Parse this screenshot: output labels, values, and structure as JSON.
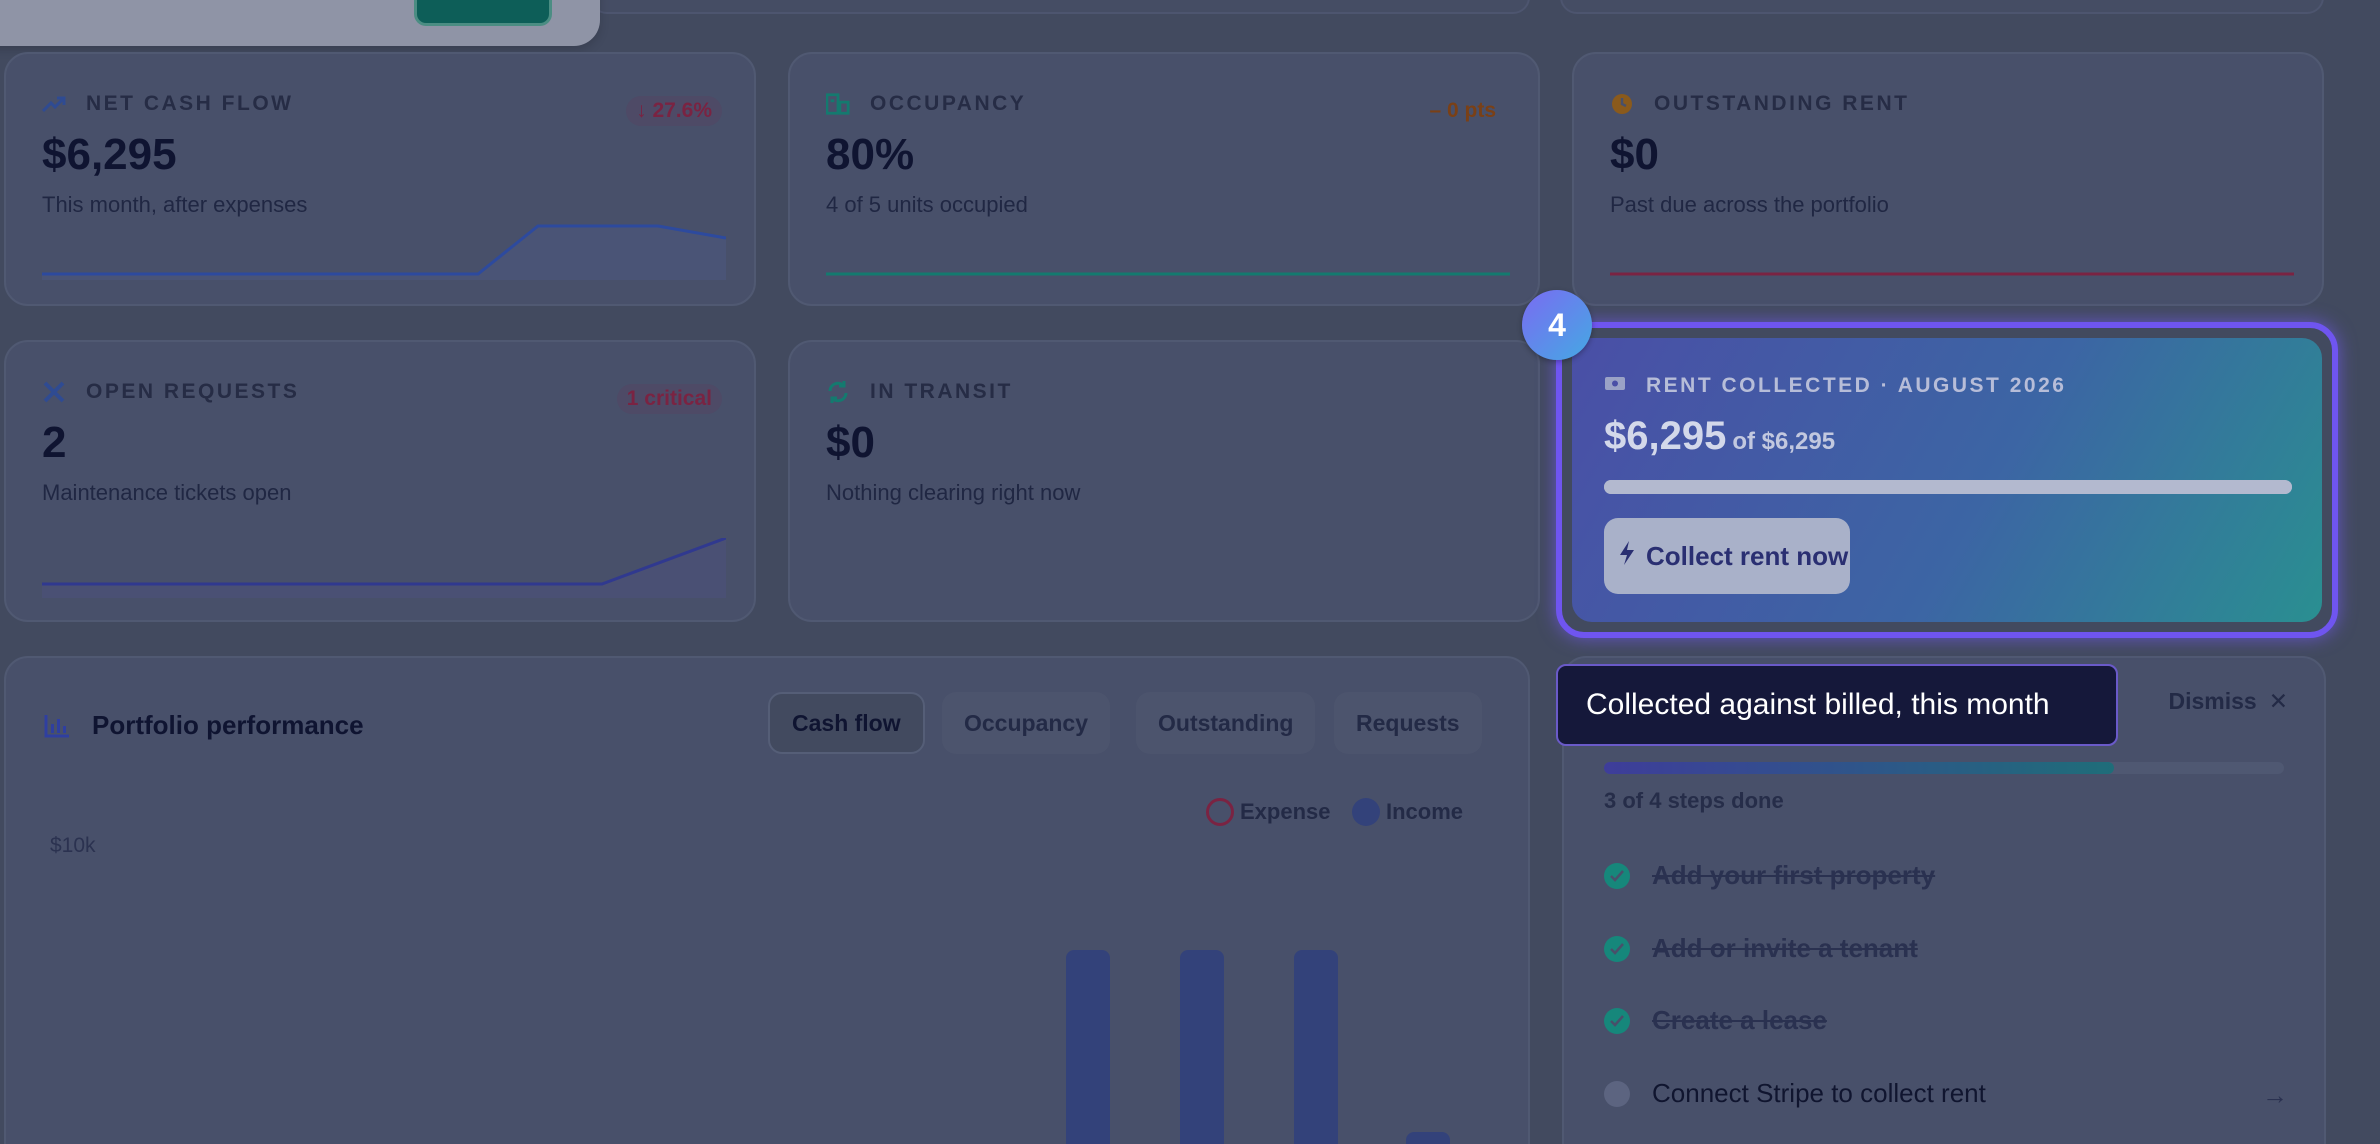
{
  "kpis": {
    "net_cash_flow": {
      "label": "NET CASH FLOW",
      "value": "$6,295",
      "sub": "This month, after expenses",
      "badge": "↓ 27.6%",
      "badge_color": "#7a2342"
    },
    "occupancy": {
      "label": "OCCUPANCY",
      "value": "80%",
      "sub": "4 of 5 units occupied",
      "badge": "– 0 pts",
      "badge_color": "#7a4016"
    },
    "outstanding_rent": {
      "label": "OUTSTANDING RENT",
      "value": "$0",
      "sub": "Past due across the portfolio"
    },
    "open_requests": {
      "label": "OPEN REQUESTS",
      "value": "2",
      "sub": "Maintenance tickets open",
      "badge": "1 critical",
      "badge_color": "#7a2342"
    },
    "in_transit": {
      "label": "IN TRANSIT",
      "value": "$0",
      "sub": "Nothing clearing right now"
    }
  },
  "rent_collected": {
    "label": "RENT COLLECTED · AUGUST 2026",
    "value": "$6,295",
    "of": "of $6,295",
    "progress": 1.0,
    "button": "Collect rent now"
  },
  "tour": {
    "step": "4",
    "tooltip": "Collected against billed, this month"
  },
  "performance": {
    "title": "Portfolio performance",
    "tabs": [
      "Cash flow",
      "Occupancy",
      "Outstanding",
      "Requests"
    ],
    "active_tab": "Cash flow",
    "legend": {
      "expense": "Expense",
      "income": "Income"
    },
    "ytick": "$10k"
  },
  "onboarding": {
    "dismiss": "Dismiss",
    "progress": 0.75,
    "count": "3 of 4 steps done",
    "steps": [
      {
        "label": "Add your first property",
        "done": true
      },
      {
        "label": "Add or invite a tenant",
        "done": true
      },
      {
        "label": "Create a lease",
        "done": true
      },
      {
        "label": "Connect Stripe to collect rent",
        "done": false
      }
    ]
  },
  "colors": {
    "accent": "#6f55f0",
    "teal": "#16877b",
    "income": "#33427a"
  }
}
